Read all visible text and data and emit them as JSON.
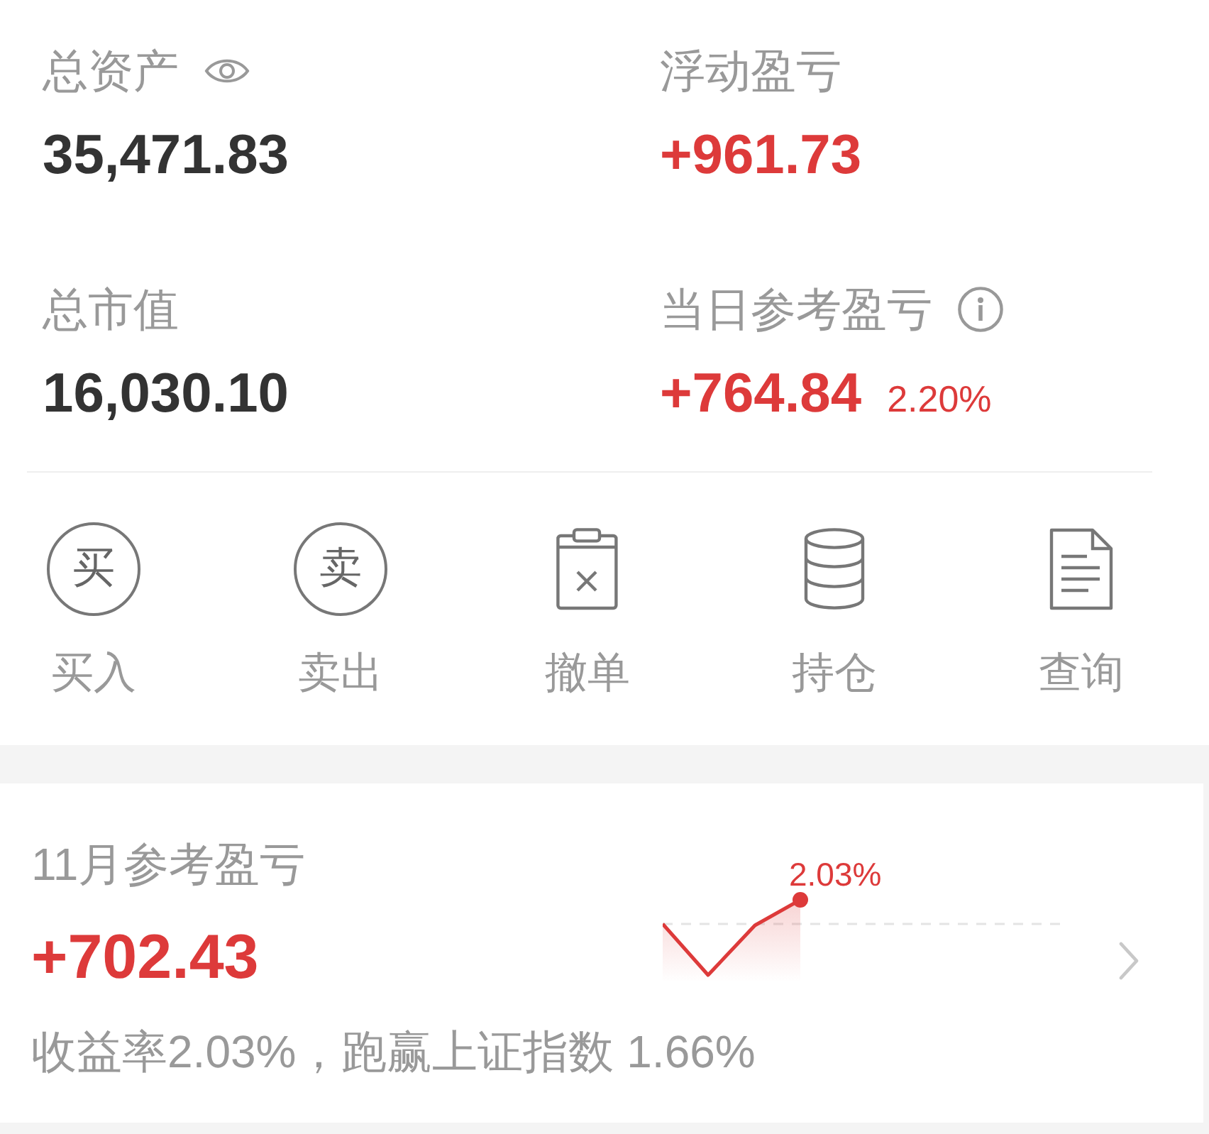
{
  "overview": {
    "total_assets": {
      "label": "总资产",
      "value": "35,471.83"
    },
    "floating_pl": {
      "label": "浮动盈亏",
      "value": "+961.73"
    },
    "market_value": {
      "label": "总市值",
      "value": "16,030.10"
    },
    "daily_pl": {
      "label": "当日参考盈亏",
      "value": "+764.84",
      "rate": "2.20%"
    }
  },
  "actions": [
    {
      "kind": "glyph",
      "glyph": "买",
      "label": "买入"
    },
    {
      "kind": "glyph",
      "glyph": "卖",
      "label": "卖出"
    },
    {
      "kind": "clipboard",
      "label": "撤单"
    },
    {
      "kind": "stack",
      "label": "持仓"
    },
    {
      "kind": "document",
      "label": "查询"
    }
  ],
  "monthly": {
    "title": "11月参考盈亏",
    "value": "+702.43",
    "summary": "收益率2.03%，跑赢上证指数 1.66%",
    "chart_label": "2.03%"
  }
}
